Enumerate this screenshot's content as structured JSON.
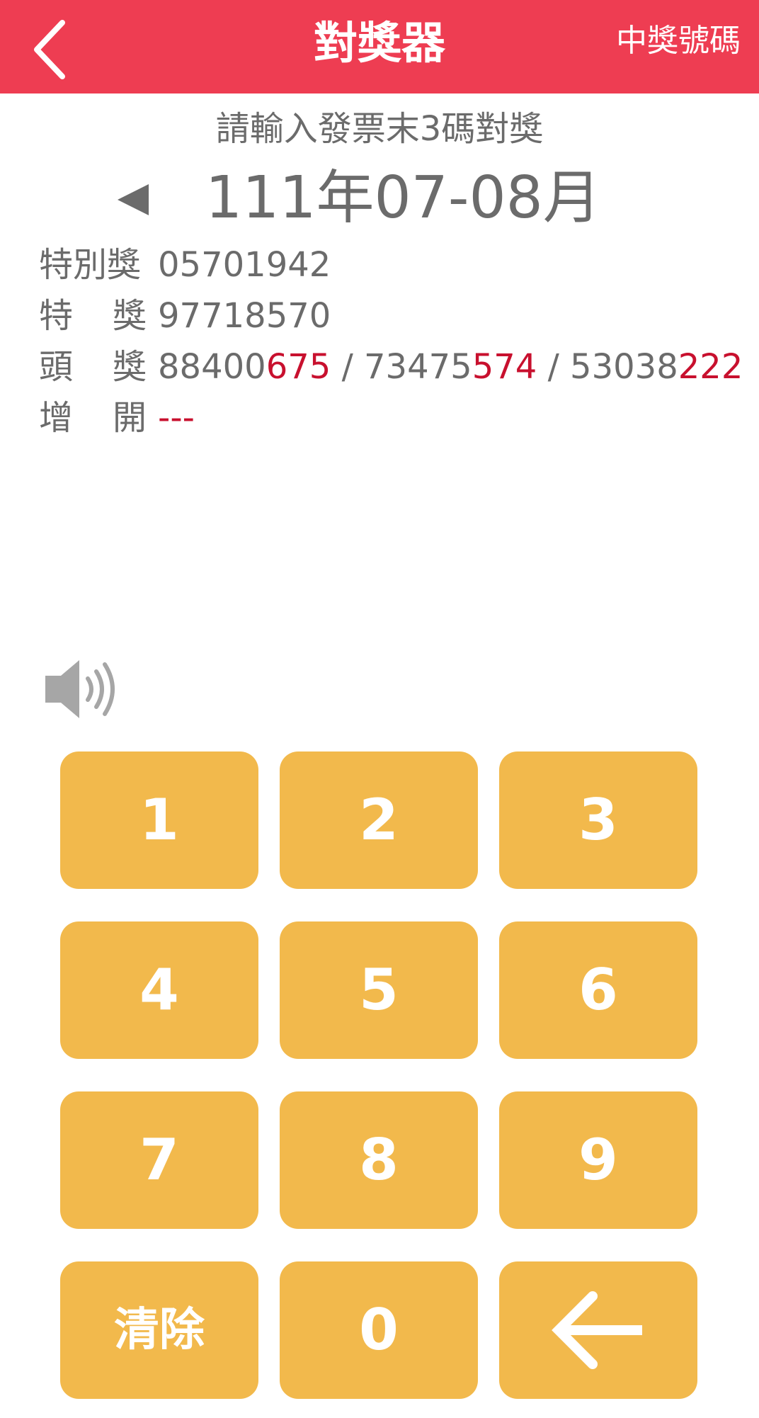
{
  "header": {
    "title": "對獎器",
    "right_link": "中獎號碼",
    "background": "#ee3d52"
  },
  "instruction": "請輸入發票末3碼對獎",
  "period": {
    "prev_icon": "left-triangle-icon",
    "label": "111年07-08月"
  },
  "prizes": {
    "special": {
      "label": "特別獎",
      "number": "05701942"
    },
    "grand": {
      "label_1": "特",
      "label_2": "獎",
      "number": "97718570"
    },
    "first": {
      "label_1": "頭",
      "label_2": "獎",
      "numbers": [
        {
          "prefix": "88400",
          "suffix": "675"
        },
        {
          "prefix": "73475",
          "suffix": "574"
        },
        {
          "prefix": "53038",
          "suffix": "222"
        }
      ],
      "separator": " / "
    },
    "extra": {
      "label_1": "增",
      "label_2": "開",
      "value": "---"
    },
    "highlight_color": "#c8102e"
  },
  "sound": {
    "icon": "speaker-icon"
  },
  "keypad": {
    "keys": [
      "1",
      "2",
      "3",
      "4",
      "5",
      "6",
      "7",
      "8",
      "9",
      "清除",
      "0"
    ],
    "backspace_icon": "backspace-arrow-icon",
    "key_color": "#f2b94c"
  }
}
